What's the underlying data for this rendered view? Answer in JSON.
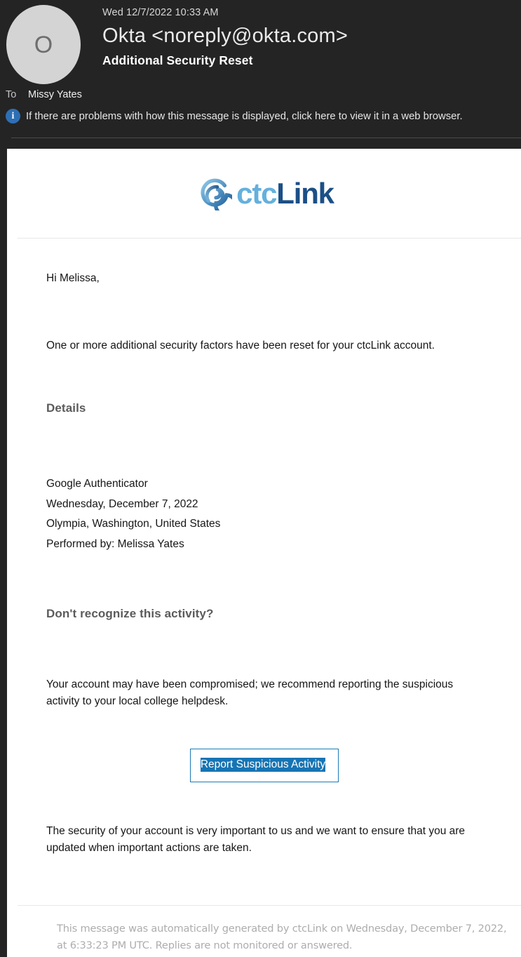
{
  "mail_header": {
    "avatar_letter": "O",
    "date": "Wed 12/7/2022 10:33 AM",
    "from": "Okta <noreply@okta.com>",
    "subject": "Additional Security Reset",
    "to_label": "To",
    "to_value": "Missy Yates",
    "info_bar_text": "If there are problems with how this message is displayed, click here to view it in a web browser.",
    "info_glyph": "i"
  },
  "brand": {
    "logo_ctc": "ctc",
    "logo_link": "Link",
    "color_ctc": "#64b0dd",
    "color_link": "#1b4f86",
    "color_mark_dark": "#1b4f86",
    "color_mark_light": "#7cc0e4"
  },
  "body": {
    "greeting": "Hi Melissa,",
    "intro": "One or more additional security factors have been reset for your ctcLink account.",
    "details_heading": "Details",
    "details": [
      "Google Authenticator",
      "Wednesday, December 7, 2022",
      "Olympia, Washington, United States",
      "Performed by: Melissa Yates"
    ],
    "recognize_heading": "Don't recognize this activity?",
    "warning": "Your account may have been compromised; we recommend reporting the suspicious activity to your local college helpdesk.",
    "cta_label": "Report Suspicious Activity",
    "cta_border_color": "#1b7ab5",
    "cta_selection_color": "#1674b4",
    "closing": "The security of your account is very important to us and we want to ensure that you are updated when important actions are taken.",
    "footer_note": "This message was automatically generated by ctcLink on Wednesday, December 7, 2022, at 6:33:23 PM UTC. Replies are not monitored or answered."
  }
}
